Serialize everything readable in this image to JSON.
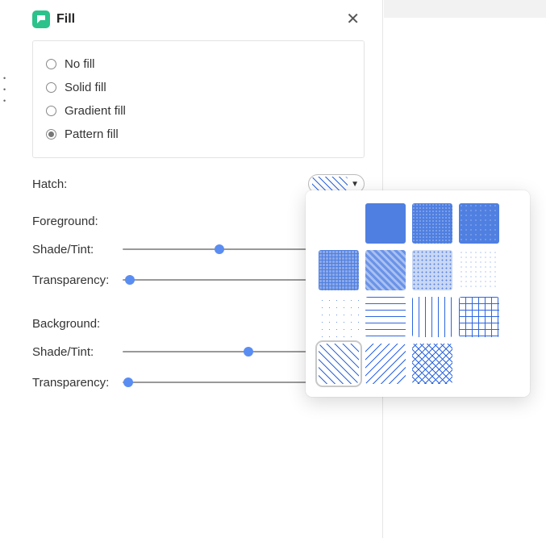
{
  "header": {
    "title": "Fill"
  },
  "fillOptions": {
    "items": [
      {
        "label": "No fill",
        "checked": false
      },
      {
        "label": "Solid fill",
        "checked": false
      },
      {
        "label": "Gradient fill",
        "checked": false
      },
      {
        "label": "Pattern fill",
        "checked": true
      }
    ]
  },
  "hatch": {
    "label": "Hatch:",
    "selectedPattern": "diagonal-forward",
    "patterns": [
      "none",
      "solid",
      "dense-dots",
      "small-dots",
      "crosshatch-50",
      "diagonal-50",
      "dots-50",
      "sparse-dots",
      "very-sparse-dots",
      "h-lines",
      "v-lines",
      "grid-lines",
      "diagonal-forward",
      "diagonal-back",
      "diagonal-cross"
    ]
  },
  "foreground": {
    "label": "Foreground:",
    "shadeLabel": "Shade/Tint:",
    "shadeValue": 40,
    "transparencyLabel": "Transparency:",
    "transparencyValue": 0
  },
  "background": {
    "label": "Background:",
    "shadeLabel": "Shade/Tint:",
    "shadeValue": 52,
    "transparencyLabel": "Transparency:",
    "transparencyValue": 0,
    "transparencyDisplay": "0 %"
  },
  "colors": {
    "accent": "#4f7fe0",
    "sliderThumb": "#5a8df2"
  }
}
